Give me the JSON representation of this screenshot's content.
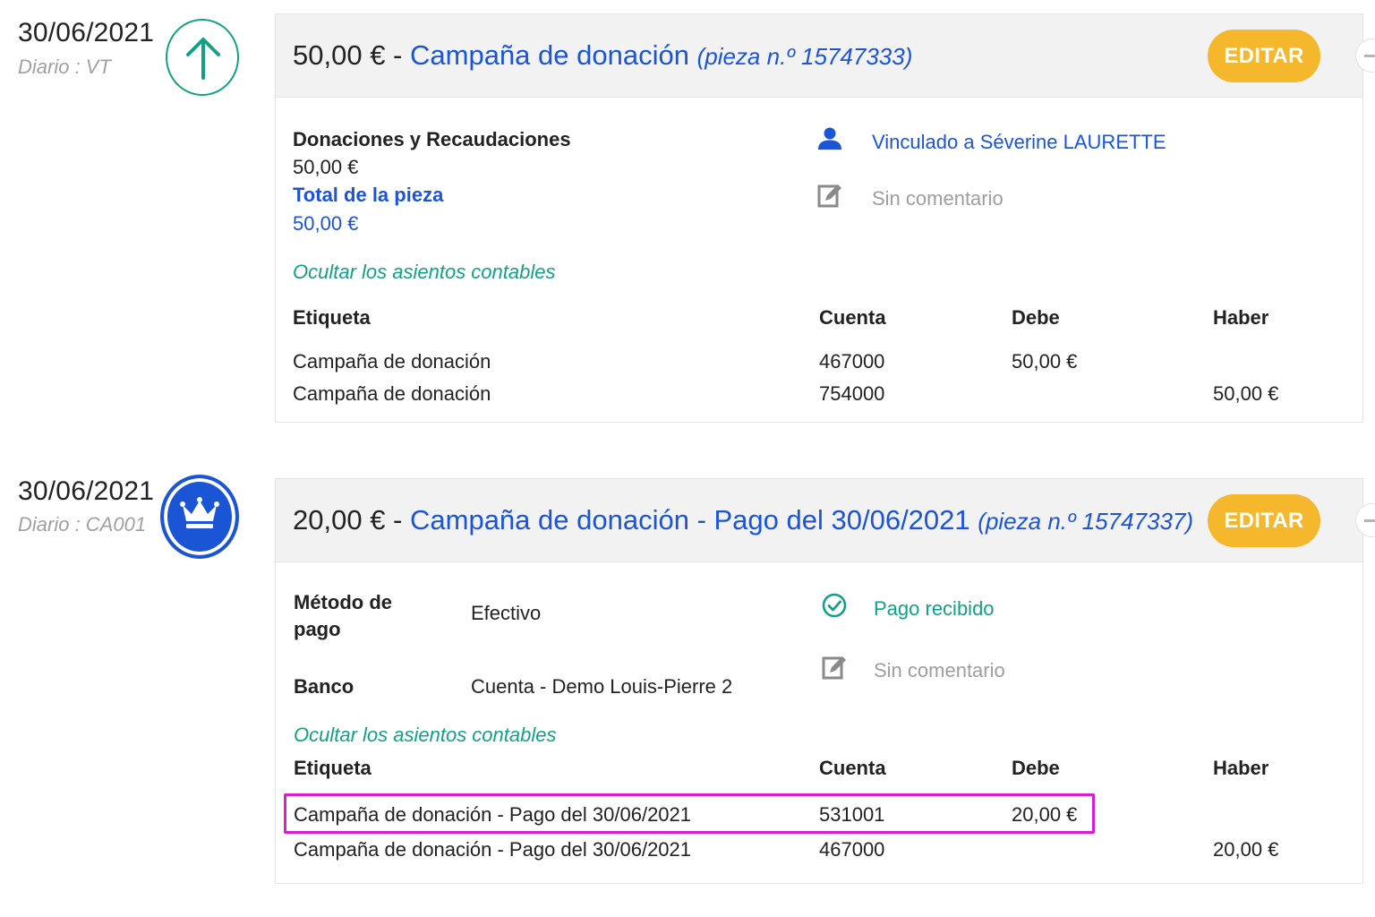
{
  "entries": [
    {
      "date": "30/06/2021",
      "journal": "Diario : VT",
      "type_icon": "arrow-up-icon",
      "header": {
        "amount": "50,00 €",
        "separator": " - ",
        "name": "Campaña de donación",
        "piece": "(pieza n.º 15747333)"
      },
      "edit_label": "EDITAR",
      "details": {
        "category": "Donaciones y Recaudaciones",
        "category_amount": "50,00 €",
        "total_label": "Total de la pieza",
        "total_amount": "50,00 €"
      },
      "side": {
        "linked": "Vinculado a Séverine LAURETTE",
        "comment": "Sin comentario"
      },
      "toggle_label": "Ocultar los asientos contables",
      "table": {
        "headers": [
          "Etiqueta",
          "Cuenta",
          "Debe",
          "Haber"
        ],
        "rows": [
          {
            "label": "Campaña de donación",
            "account": "467000",
            "debit": "50,00 €",
            "credit": ""
          },
          {
            "label": "Campaña de donación",
            "account": "754000",
            "debit": "",
            "credit": "50,00 €"
          }
        ]
      }
    },
    {
      "date": "30/06/2021",
      "journal": "Diario : CA001",
      "type_icon": "crown-icon",
      "header": {
        "amount": "20,00 €",
        "separator": " - ",
        "name": "Campaña de donación - Pago del 30/06/2021",
        "piece": "(pieza n.º 15747337)"
      },
      "edit_label": "EDITAR",
      "details": {
        "method_label_1": "Método de",
        "method_label_2": "pago",
        "method_value": "Efectivo",
        "bank_label": "Banco",
        "bank_value": "Cuenta - Demo Louis-Pierre 2"
      },
      "side": {
        "status": "Pago recibido",
        "comment": "Sin comentario"
      },
      "toggle_label": "Ocultar los asientos contables",
      "table": {
        "headers": [
          "Etiqueta",
          "Cuenta",
          "Debe",
          "Haber"
        ],
        "rows": [
          {
            "label": "Campaña de donación - Pago del 30/06/2021",
            "account": "531001",
            "debit": "20,00 €",
            "credit": ""
          },
          {
            "label": "Campaña de donación - Pago del 30/06/2021",
            "account": "467000",
            "debit": "",
            "credit": "20,00 €"
          }
        ]
      }
    }
  ],
  "colors": {
    "accent_blue": "#1a55d6",
    "accent_green": "#13a185",
    "edit_button": "#f5b72b",
    "highlight": "#d81fd0"
  }
}
